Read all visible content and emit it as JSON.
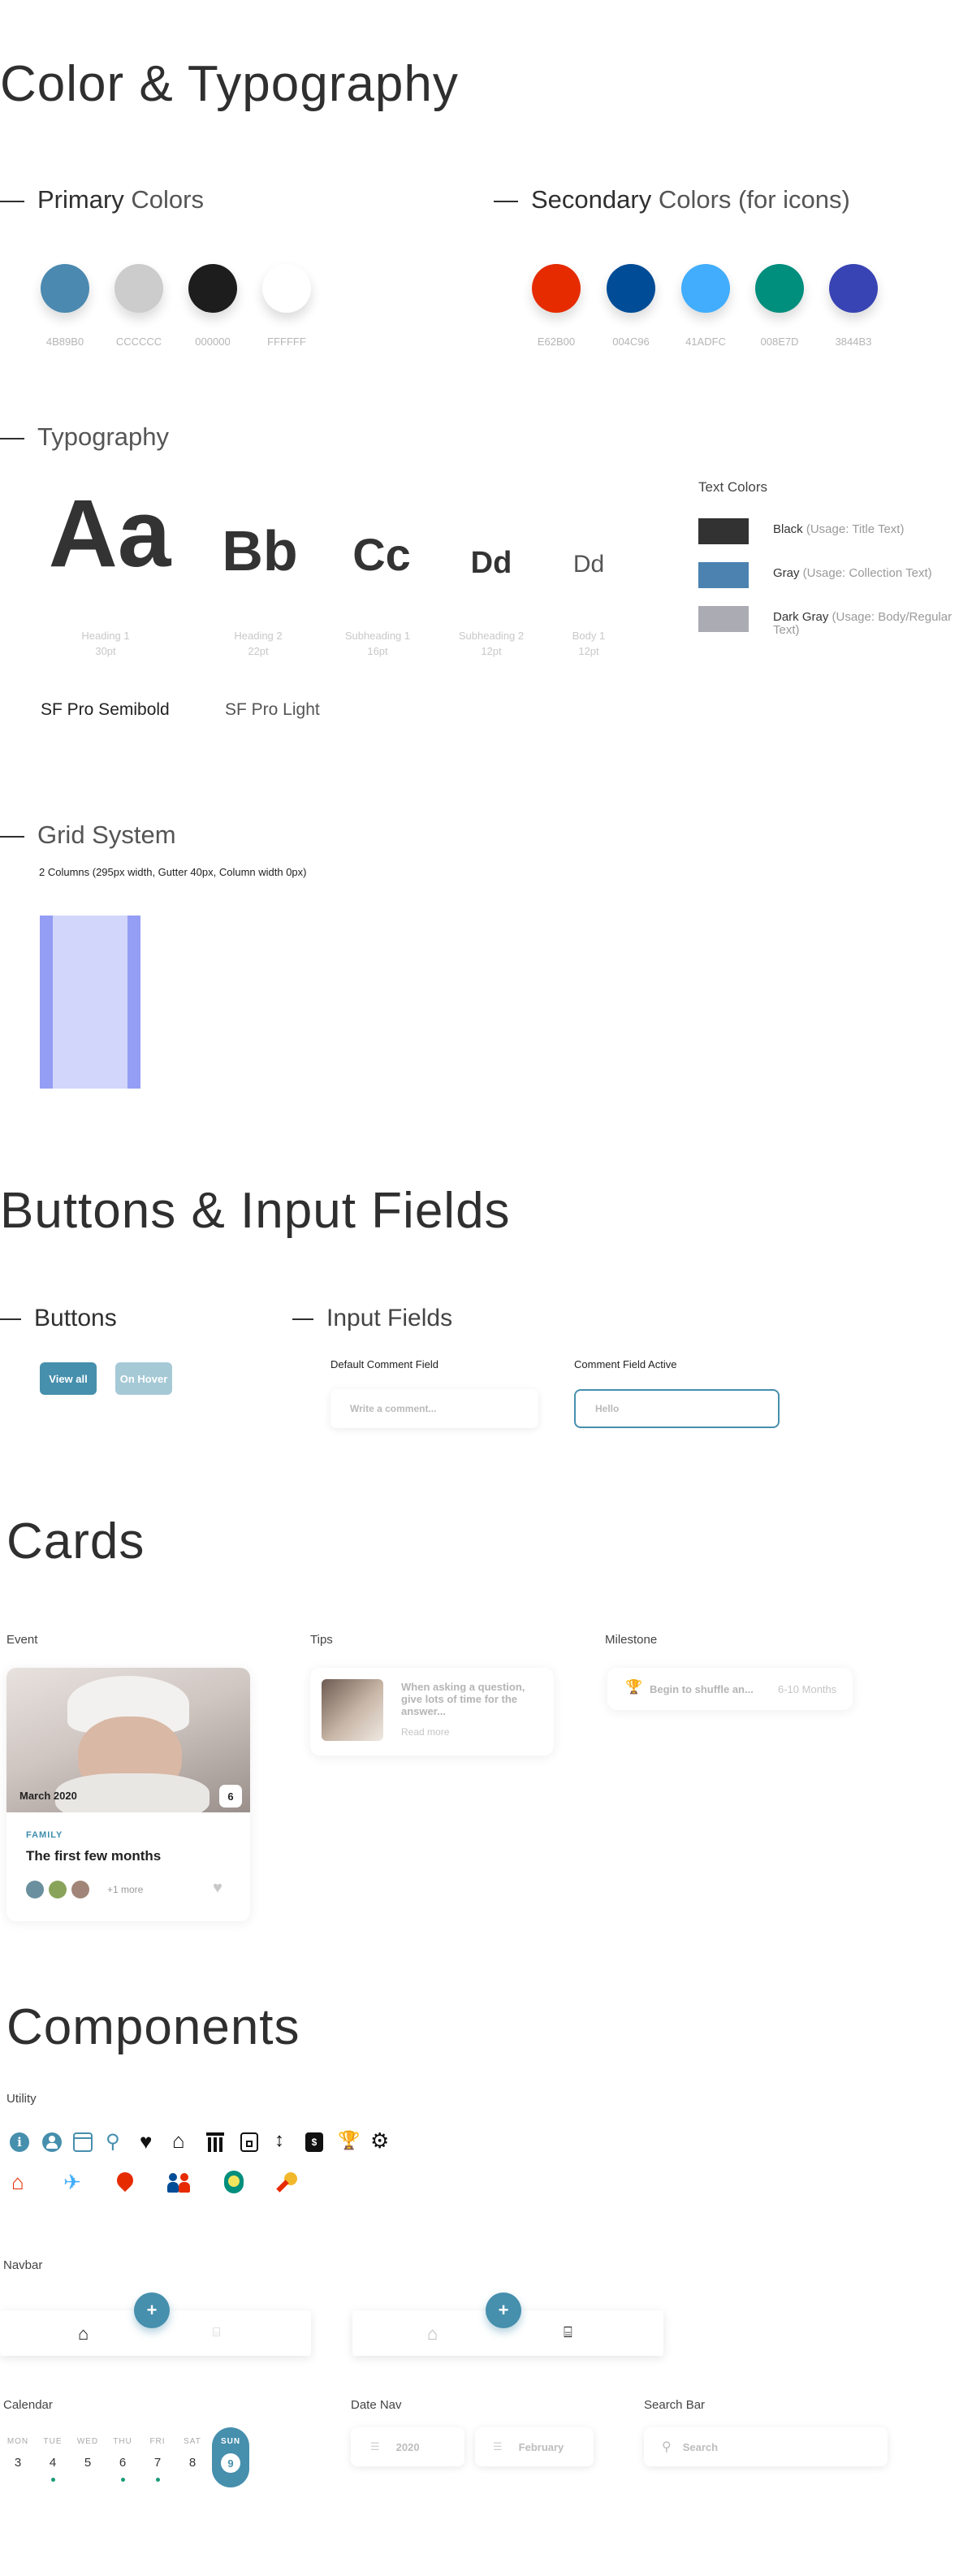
{
  "colortypo": {
    "title": "Color & Typography",
    "primary": {
      "bold": "Primary",
      "rest": " Colors",
      "swatches": [
        {
          "hex": "#4B89B0",
          "label": "4B89B0"
        },
        {
          "hex": "#CCCCCC",
          "label": "CCCCCC"
        },
        {
          "hex": "#1D1D1D",
          "label": "000000"
        },
        {
          "hex": "#FFFFFF",
          "label": "FFFFFF"
        }
      ]
    },
    "secondary": {
      "bold": "Secondary",
      "rest": " Colors (for icons)",
      "swatches": [
        {
          "hex": "#E62B00",
          "label": "E62B00"
        },
        {
          "hex": "#004C96",
          "label": "004C96"
        },
        {
          "hex": "#41ADFC",
          "label": "41ADFC"
        },
        {
          "hex": "#008E7D",
          "label": "008E7D"
        },
        {
          "hex": "#3844B3",
          "label": "3844B3"
        }
      ]
    },
    "typography": {
      "title": "Typography",
      "samples": [
        {
          "text": "Aa",
          "l1": "Heading 1",
          "l2": "30pt"
        },
        {
          "text": "Bb",
          "l1": "Heading 2",
          "l2": "22pt"
        },
        {
          "text": "Cc",
          "l1": "Subheading 1",
          "l2": "16pt"
        },
        {
          "text": "Dd",
          "l1": "Subheading 2",
          "l2": "12pt"
        },
        {
          "text": "Dd",
          "l1": "Body 1",
          "l2": "12pt"
        }
      ],
      "font_semibold": "SF Pro Semibold",
      "font_light": "SF Pro Light"
    },
    "text_colors": {
      "title": "Text Colors",
      "items": [
        {
          "name": "Black",
          "usage": " (Usage: Title Text)",
          "hex": "#323232"
        },
        {
          "name": "Gray",
          "usage": " (Usage: Collection Text)",
          "hex": "#4B82B0"
        },
        {
          "name": "Dark Gray",
          "usage": " (Usage: Body/Regular Text)",
          "hex": "#ABABB3"
        }
      ]
    },
    "grid": {
      "title": "Grid System",
      "desc": "2 Columns (295px width, Gutter 40px, Column width 0px)"
    }
  },
  "buttons_inputs": {
    "title": "Buttons & Input Fields",
    "buttons": {
      "title": "Buttons",
      "view_all": "View all",
      "hover": "On Hover"
    },
    "inputs": {
      "title": "Input Fields",
      "default_label": "Default Comment Field",
      "default_placeholder": "Write a comment...",
      "active_label": "Comment Field Active",
      "active_value": "Hello"
    }
  },
  "cards": {
    "title": "Cards",
    "event": {
      "label": "Event",
      "date": "March 2020",
      "count": "6",
      "category": "FAMILY",
      "title": "The first few months",
      "more": "+1 more"
    },
    "tips": {
      "label": "Tips",
      "text": "When asking a question, give lots of time for the answer...",
      "read_more": "Read more"
    },
    "milestone": {
      "label": "Milestone",
      "text": "Begin to shuffle an...",
      "range": "6-10 Months"
    }
  },
  "components": {
    "title": "Components",
    "utility_label": "Utility",
    "navbar_label": "Navbar",
    "calendar": {
      "label": "Calendar",
      "days": [
        {
          "name": "MON",
          "num": "3",
          "dot": false
        },
        {
          "name": "TUE",
          "num": "4",
          "dot": true
        },
        {
          "name": "WED",
          "num": "5",
          "dot": false
        },
        {
          "name": "THU",
          "num": "6",
          "dot": true
        },
        {
          "name": "FRI",
          "num": "7",
          "dot": true
        },
        {
          "name": "SAT",
          "num": "8",
          "dot": false
        },
        {
          "name": "SUN",
          "num": "9",
          "dot": false,
          "selected": true
        }
      ]
    },
    "date_nav": {
      "label": "Date Nav",
      "year": "2020",
      "month": "February"
    },
    "search": {
      "label": "Search Bar",
      "placeholder": "Search"
    }
  },
  "colors": {
    "accent": "#468FAD",
    "accent_light": "#A6C9D6",
    "grid_gutter": "#949EF5",
    "grid_column": "#D2D6FB",
    "category": "#3D8DAD"
  }
}
